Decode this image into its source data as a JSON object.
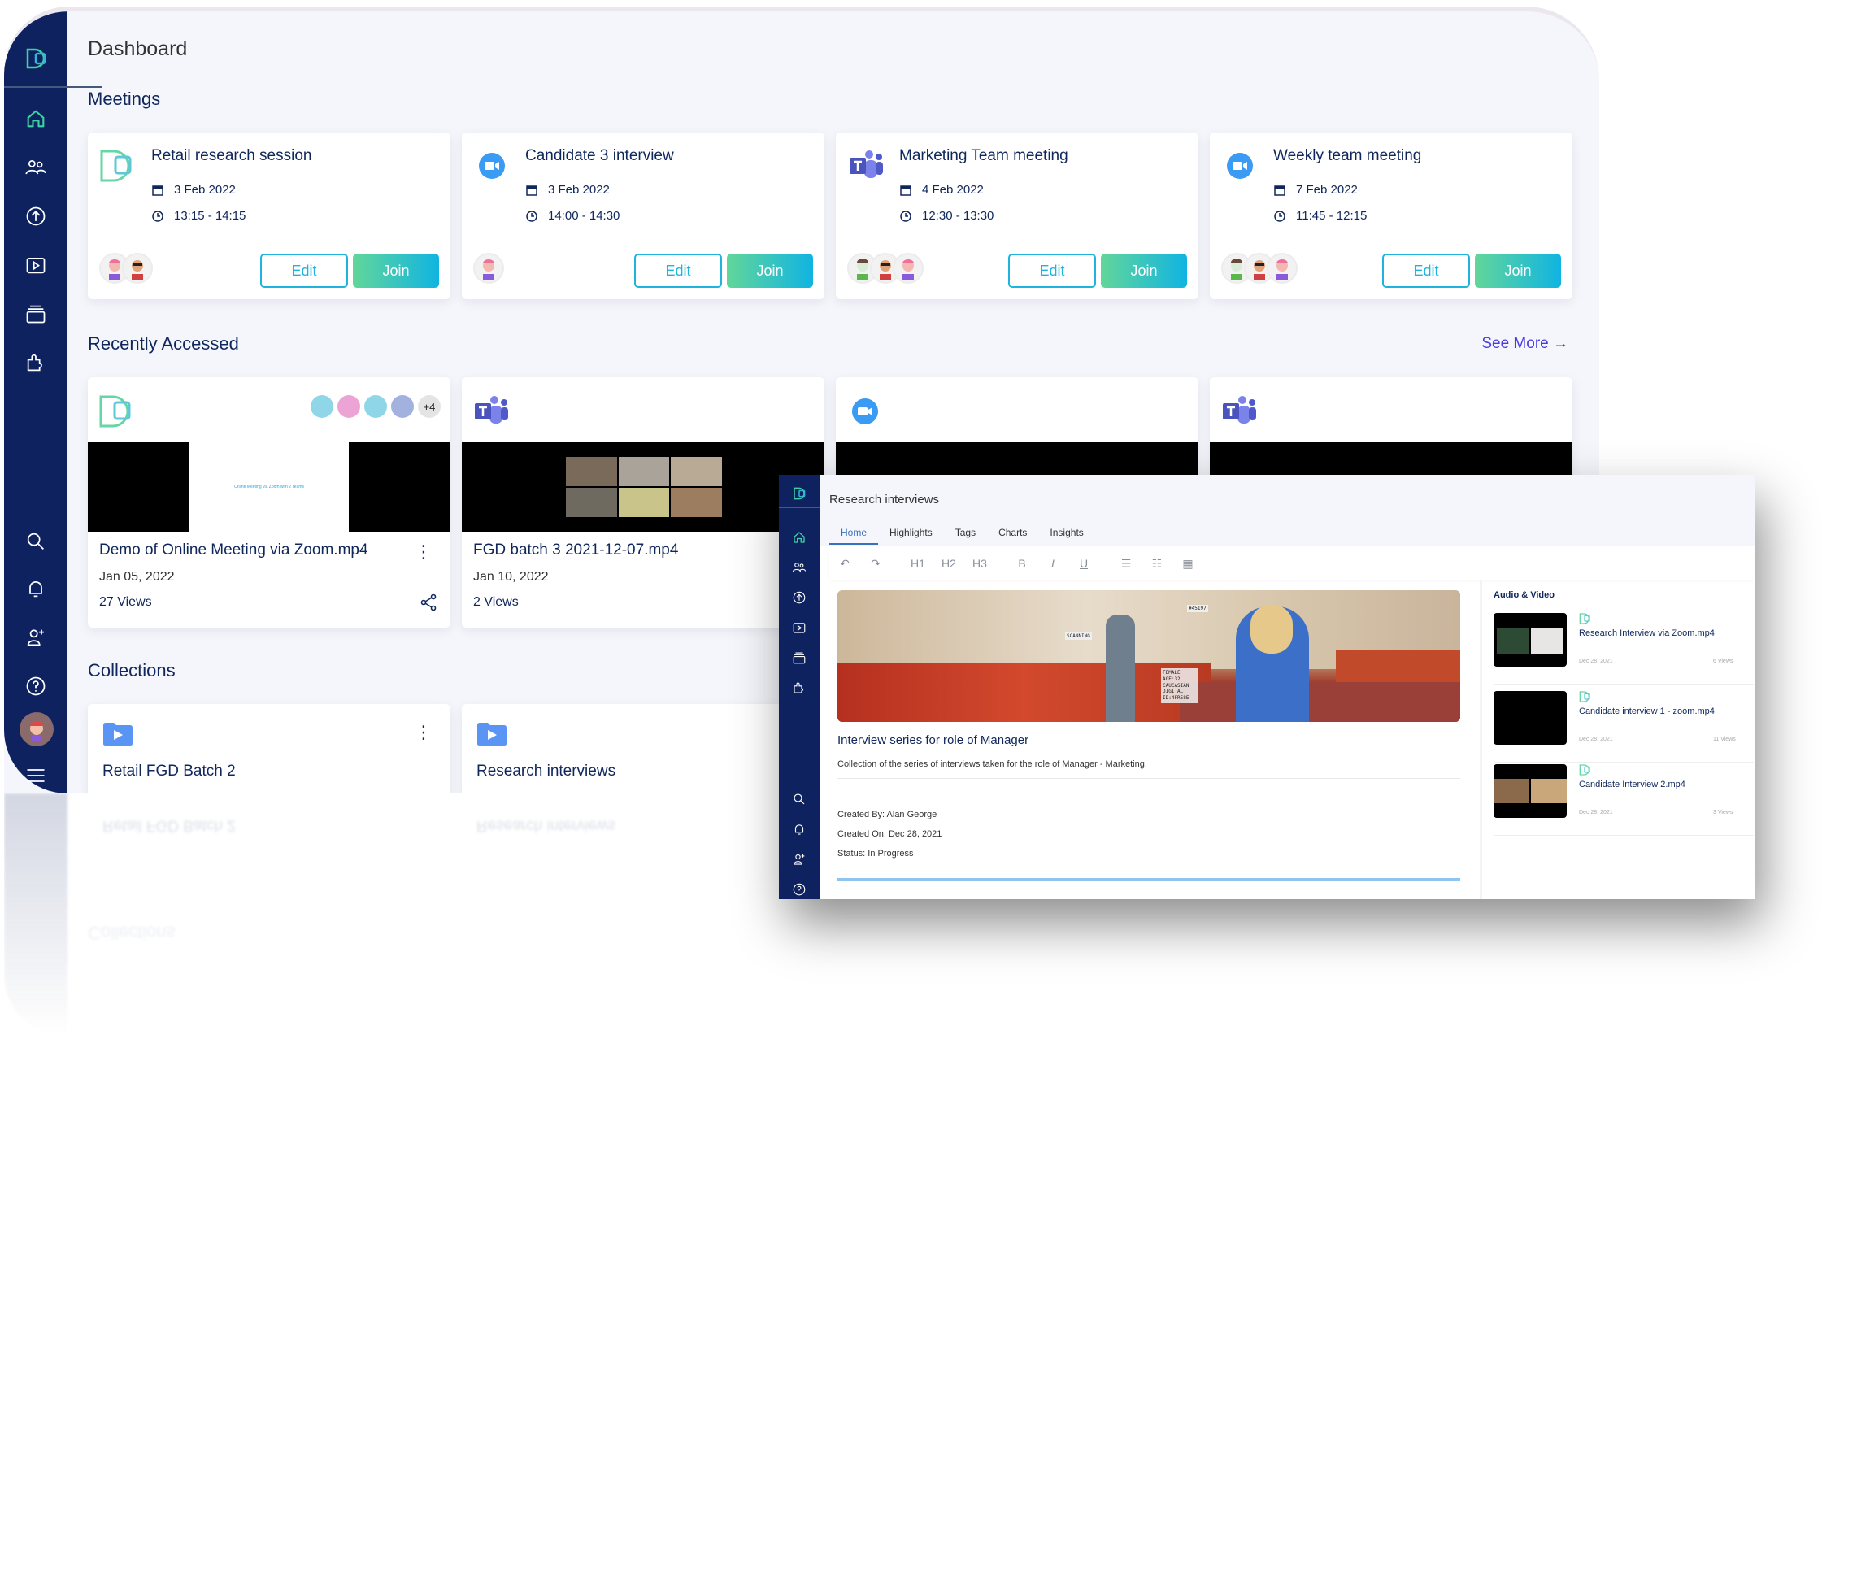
{
  "dashboard": {
    "title": "Dashboard",
    "sidebar": {
      "logo": "app-logo",
      "top_items": [
        "home",
        "participants",
        "upload",
        "media",
        "collections",
        "integrations"
      ],
      "bottom_items": [
        "search",
        "notifications",
        "add-user",
        "help",
        "profile",
        "menu"
      ]
    },
    "meetings": {
      "title": "Meetings",
      "items": [
        {
          "title": "Retail research session",
          "platform": "app",
          "date": "3 Feb 2022",
          "time": "13:15 - 14:15",
          "participants": 2,
          "edit": "Edit",
          "join": "Join"
        },
        {
          "title": "Candidate 3 interview",
          "platform": "zoom",
          "date": "3 Feb 2022",
          "time": "14:00 - 14:30",
          "participants": 1,
          "edit": "Edit",
          "join": "Join"
        },
        {
          "title": "Marketing Team meeting",
          "platform": "teams",
          "date": "4 Feb 2022",
          "time": "12:30 - 13:30",
          "participants": 3,
          "edit": "Edit",
          "join": "Join"
        },
        {
          "title": "Weekly team meeting",
          "platform": "zoom",
          "date": "7 Feb 2022",
          "time": "11:45 - 12:15",
          "participants": 3,
          "edit": "Edit",
          "join": "Join"
        }
      ]
    },
    "recent": {
      "title": "Recently Accessed",
      "see_more": "See More →",
      "items": [
        {
          "title": "Demo of Online Meeting via Zoom.mp4",
          "platform": "app",
          "date": "Jan 05, 2022",
          "views": "27 Views",
          "thumb_caption": "Online Meeting via Zoom with 2 Teams",
          "extra_participants": "+4",
          "participant_colors": [
            "#8fd6e8",
            "#eba4d4",
            "#8fd6e8",
            "#a3b1de"
          ]
        },
        {
          "title": "FGD batch 3 2021-12-07.mp4",
          "platform": "teams",
          "date": "Jan 10, 2022",
          "views": "2 Views"
        },
        {
          "title": "",
          "platform": "zoom",
          "date": "",
          "views": ""
        },
        {
          "title": "",
          "platform": "teams",
          "date": "",
          "views": ""
        }
      ]
    },
    "collections": {
      "title": "Collections",
      "items": [
        {
          "title": "Retail FGD Batch 2"
        },
        {
          "title": "Research interviews"
        }
      ]
    }
  },
  "panel": {
    "title": "Research interviews",
    "tabs": [
      {
        "label": "Home",
        "active": true
      },
      {
        "label": "Highlights",
        "active": false
      },
      {
        "label": "Tags",
        "active": false
      },
      {
        "label": "Charts",
        "active": false
      },
      {
        "label": "Insights",
        "active": false
      }
    ],
    "toolbar": [
      "undo",
      "redo",
      "H1",
      "H2",
      "H3",
      "B",
      "I",
      "U",
      "bullet-list",
      "numbered-list",
      "table"
    ],
    "banner_labels": {
      "scan": "SCANNING",
      "id": "#45197",
      "info": "FEMALE AGE:32 CAUCASIAN DIGITAL ID:4FR58E"
    },
    "collection_title": "Interview series for role of Manager",
    "description": "Collection of the series of interviews taken for the role of Manager - Marketing.",
    "created_by": "Created By: Alan George",
    "created_on": "Created On: Dec 28, 2021",
    "status": "Status: In Progress",
    "progress": 1.0,
    "media": {
      "title": "Audio & Video",
      "items": [
        {
          "name": "Research Interview via Zoom.mp4",
          "date": "Dec 28, 2021",
          "views": "6 Views"
        },
        {
          "name": "Candidate interview 1 - zoom.mp4",
          "date": "Dec 28, 2021",
          "views": "11 Views"
        },
        {
          "name": "Candidate Interview 2.mp4",
          "date": "Dec 28, 2021",
          "views": "3 Views"
        }
      ]
    }
  },
  "colors": {
    "sidebar": "#0e2260",
    "accent_teal": "#1fb4de",
    "join_gradient_start": "#62d69a",
    "join_gradient_end": "#10b4e2",
    "link": "#4a3de0",
    "text_primary": "#10275c"
  }
}
